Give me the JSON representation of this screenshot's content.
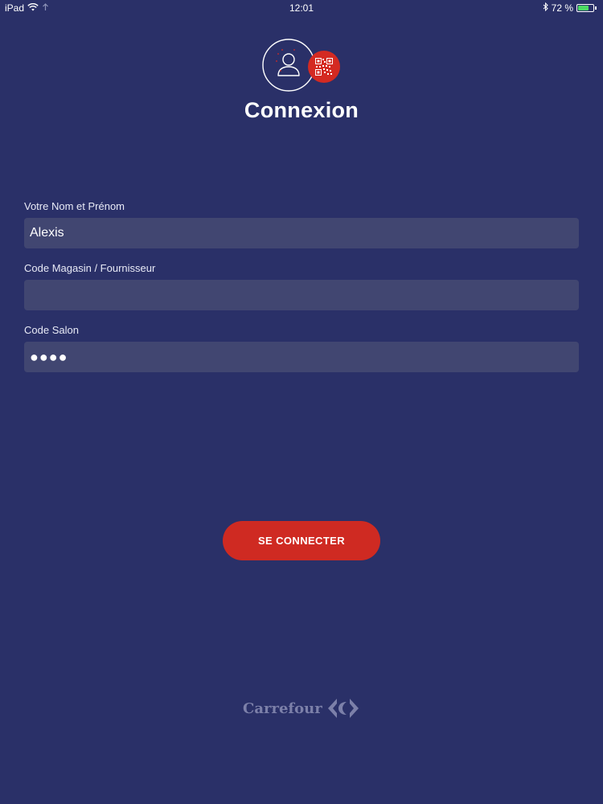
{
  "status_bar": {
    "device": "iPad",
    "time": "12:01",
    "battery": "72 %"
  },
  "header": {
    "title": "Connexion"
  },
  "form": {
    "name": {
      "label": "Votre Nom et Prénom",
      "value": "Alexis"
    },
    "store_code": {
      "label": "Code Magasin / Fournisseur",
      "value": ""
    },
    "salon_code": {
      "label": "Code Salon",
      "value": "●●●●"
    }
  },
  "actions": {
    "connect_label": "SE CONNECTER"
  },
  "brand": {
    "name": "Carrefour"
  },
  "colors": {
    "background": "#2a3068",
    "input_bg": "#414671",
    "accent": "#cf2a22",
    "battery": "#4cd964"
  }
}
